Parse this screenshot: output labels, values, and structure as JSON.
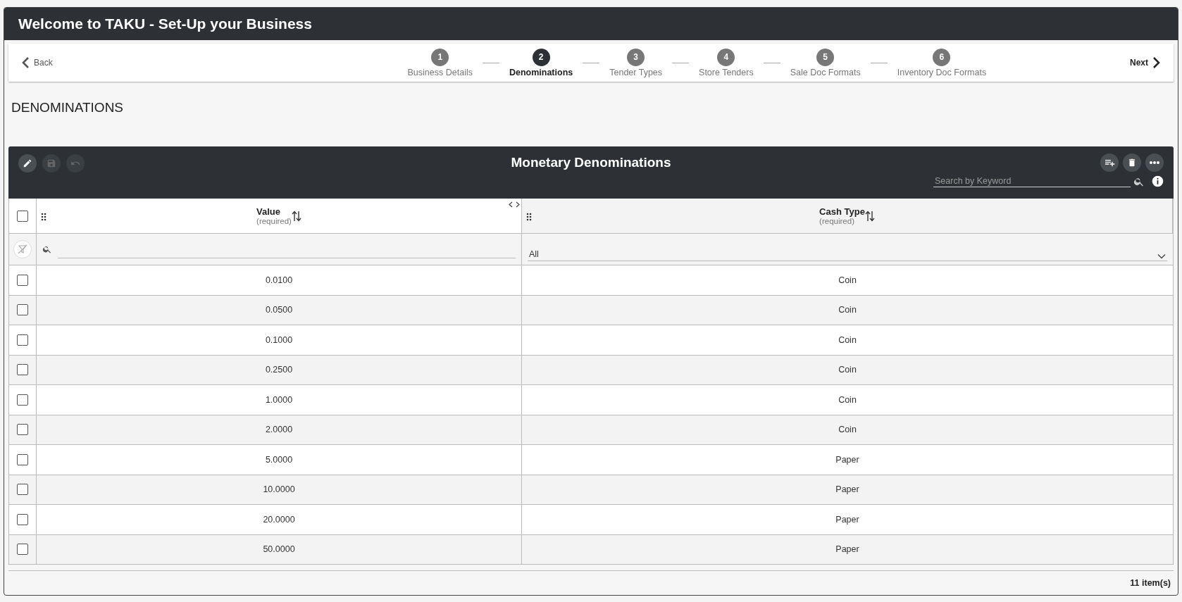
{
  "window": {
    "title": "Welcome to TAKU - Set-Up your Business"
  },
  "nav": {
    "back": "Back",
    "next": "Next"
  },
  "steps": [
    {
      "number": "1",
      "label": "Business Details",
      "selected": false
    },
    {
      "number": "2",
      "label": "Denominations",
      "selected": true
    },
    {
      "number": "3",
      "label": "Tender Types",
      "selected": false
    },
    {
      "number": "4",
      "label": "Store Tenders",
      "selected": false
    },
    {
      "number": "5",
      "label": "Sale Doc Formats",
      "selected": false
    },
    {
      "number": "6",
      "label": "Inventory Doc Formats",
      "selected": false
    }
  ],
  "section_title": "DENOMINATIONS",
  "table": {
    "title": "Monetary Denominations",
    "search": {
      "placeholder": "Search by Keyword"
    },
    "columns": [
      {
        "label": "Value",
        "note": "(required)"
      },
      {
        "label": "Cash Type",
        "note": "(required)"
      }
    ],
    "select_all": {
      "checked": false
    },
    "filter": {
      "cash_type": "All"
    },
    "rows": [
      {
        "value": "0.0100",
        "cash_type": "Coin",
        "checked": false
      },
      {
        "value": "0.0500",
        "cash_type": "Coin",
        "checked": false
      },
      {
        "value": "0.1000",
        "cash_type": "Coin",
        "checked": false
      },
      {
        "value": "0.2500",
        "cash_type": "Coin",
        "checked": false
      },
      {
        "value": "1.0000",
        "cash_type": "Coin",
        "checked": false
      },
      {
        "value": "2.0000",
        "cash_type": "Coin",
        "checked": false
      },
      {
        "value": "5.0000",
        "cash_type": "Paper",
        "checked": false
      },
      {
        "value": "10.0000",
        "cash_type": "Paper",
        "checked": false
      },
      {
        "value": "20.0000",
        "cash_type": "Paper",
        "checked": false
      },
      {
        "value": "50.0000",
        "cash_type": "Paper",
        "checked": false
      }
    ],
    "count": "11 item(s)"
  }
}
